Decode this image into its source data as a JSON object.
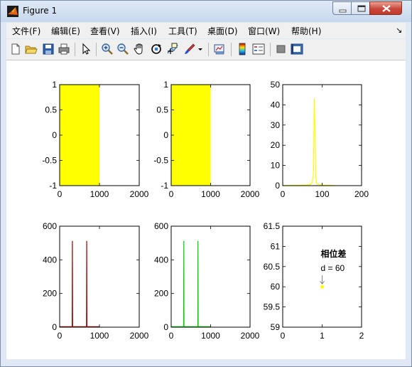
{
  "window": {
    "title": "Figure 1"
  },
  "menu": {
    "items": [
      "文件(F)",
      "编辑(E)",
      "查看(V)",
      "插入(I)",
      "工具(T)",
      "桌面(D)",
      "窗口(W)",
      "帮助(H)"
    ],
    "dock_glyph": "↘"
  },
  "toolbar": {
    "icons": [
      "new-figure-icon",
      "open-file-icon",
      "save-icon",
      "print-icon",
      "edit-plot-arrow-icon",
      "zoom-in-icon",
      "zoom-out-icon",
      "pan-hand-icon",
      "rotate-3d-icon",
      "data-cursor-icon",
      "brush-icon",
      "link-plot-icon",
      "colorbar-icon",
      "legend-icon",
      "hide-plot-tools-icon",
      "show-plot-tools-icon"
    ]
  },
  "colors": {
    "yellow": "#ffff00",
    "darkred": "#990000",
    "green": "#00cc00"
  },
  "chart_data": [
    {
      "type": "area",
      "xlim": [
        0,
        2000
      ],
      "ylim": [
        -1,
        1
      ],
      "xticks": [
        "0",
        "1000",
        "2000"
      ],
      "yticks": [
        "-1",
        "-0.5",
        "0",
        "0.5",
        "1"
      ],
      "fill": {
        "x": [
          0,
          1000
        ],
        "y": [
          -1,
          1
        ],
        "color": "#ffff00"
      }
    },
    {
      "type": "area",
      "xlim": [
        0,
        2000
      ],
      "ylim": [
        -1,
        1
      ],
      "xticks": [
        "0",
        "1000",
        "2000"
      ],
      "yticks": [
        "-1",
        "-0.5",
        "0",
        "0.5",
        "1"
      ],
      "fill": {
        "x": [
          0,
          1000
        ],
        "y": [
          -1,
          1
        ],
        "color": "#ffff00"
      }
    },
    {
      "type": "line",
      "xlim": [
        0,
        200
      ],
      "ylim": [
        0,
        50
      ],
      "xticks": [
        "0",
        "100",
        "200"
      ],
      "yticks": [
        "0",
        "10",
        "20",
        "30",
        "40",
        "50"
      ],
      "series": [
        {
          "color": "#ffff00",
          "x": [
            0,
            60,
            70,
            75,
            78,
            80,
            82,
            84,
            86,
            90,
            100,
            130
          ],
          "y": [
            0.1,
            0.3,
            0.6,
            1.5,
            6,
            43,
            27,
            4,
            1.2,
            0.5,
            0.3,
            0.1
          ]
        }
      ]
    },
    {
      "type": "line",
      "xlim": [
        0,
        2000
      ],
      "ylim": [
        0,
        600
      ],
      "xticks": [
        "0",
        "1000",
        "2000"
      ],
      "yticks": [
        "0",
        "200",
        "400",
        "600"
      ],
      "series": [
        {
          "color": "#990000",
          "x": [
            0,
            315,
            320,
            325,
            675,
            680,
            685,
            1000
          ],
          "y": [
            3,
            3,
            512,
            3,
            3,
            512,
            3,
            3
          ]
        }
      ]
    },
    {
      "type": "line",
      "xlim": [
        0,
        2000
      ],
      "ylim": [
        0,
        600
      ],
      "xticks": [
        "0",
        "1000",
        "2000"
      ],
      "yticks": [
        "0",
        "200",
        "400",
        "600"
      ],
      "series": [
        {
          "color": "#00cc00",
          "x": [
            0,
            315,
            320,
            325,
            675,
            680,
            685,
            1000
          ],
          "y": [
            3,
            3,
            512,
            3,
            3,
            512,
            3,
            3
          ]
        }
      ]
    },
    {
      "type": "scatter",
      "xlim": [
        0,
        2
      ],
      "ylim": [
        59,
        61.5
      ],
      "xticks": [
        "0",
        "1",
        "2"
      ],
      "yticks": [
        "59",
        "59.5",
        "60",
        "60.5",
        "61",
        "61.5"
      ],
      "series": [
        {
          "color": "#ffff00",
          "x": [
            1
          ],
          "y": [
            60
          ]
        }
      ],
      "annotation": {
        "label": "相位差",
        "text": "d = 60"
      }
    }
  ]
}
